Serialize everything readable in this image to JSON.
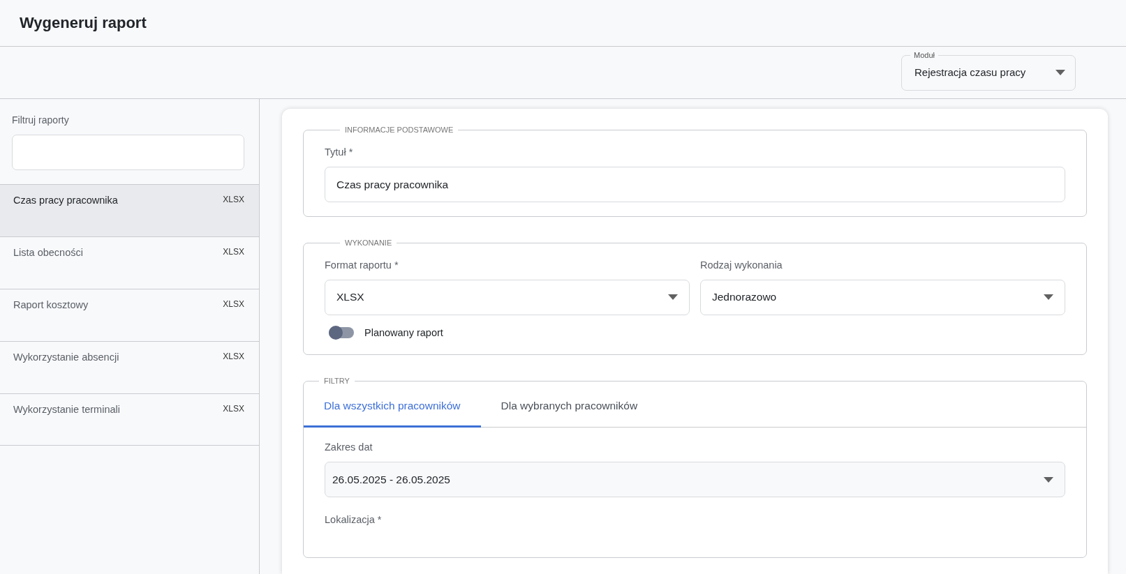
{
  "page": {
    "title": "Wygeneruj raport"
  },
  "module_select": {
    "label": "Moduł",
    "value": "Rejestracja czasu pracy"
  },
  "sidebar": {
    "filter_label": "Filtruj raporty",
    "items": [
      {
        "name": "Czas pracy pracownika",
        "format": "XLSX",
        "selected": true
      },
      {
        "name": "Lista obecności",
        "format": "XLSX",
        "selected": false
      },
      {
        "name": "Raport kosztowy",
        "format": "XLSX",
        "selected": false
      },
      {
        "name": "Wykorzystanie absencji",
        "format": "XLSX",
        "selected": false
      },
      {
        "name": "Wykorzystanie terminali",
        "format": "XLSX",
        "selected": false
      }
    ]
  },
  "sections": [
    {
      "legend": "INFORMACJE PODSTAWOWE",
      "fields": [
        {
          "kind": "text",
          "label": "Tytuł *",
          "value": "Czas pracy pracownika"
        }
      ]
    },
    {
      "legend": "WYKONANIE",
      "fields": [
        {
          "kind": "select",
          "label": "Format raportu *",
          "value": "XLSX"
        },
        {
          "kind": "select",
          "label": "Rodzaj wykonania",
          "value": "Jednorazowo"
        }
      ],
      "switch": {
        "label": "Planowany raport",
        "on": false
      }
    },
    {
      "legend": "FILTRY",
      "tabs": [
        {
          "label": "Dla wszystkich pracowników",
          "selected": true
        },
        {
          "label": "Dla wybranych pracowników",
          "selected": false
        }
      ],
      "fields": [
        {
          "kind": "daterange",
          "label": "Zakres dat",
          "value": "26.05.2025 - 26.05.2025"
        },
        {
          "kind": "label",
          "label": "Lokalizacja *"
        }
      ]
    }
  ]
}
